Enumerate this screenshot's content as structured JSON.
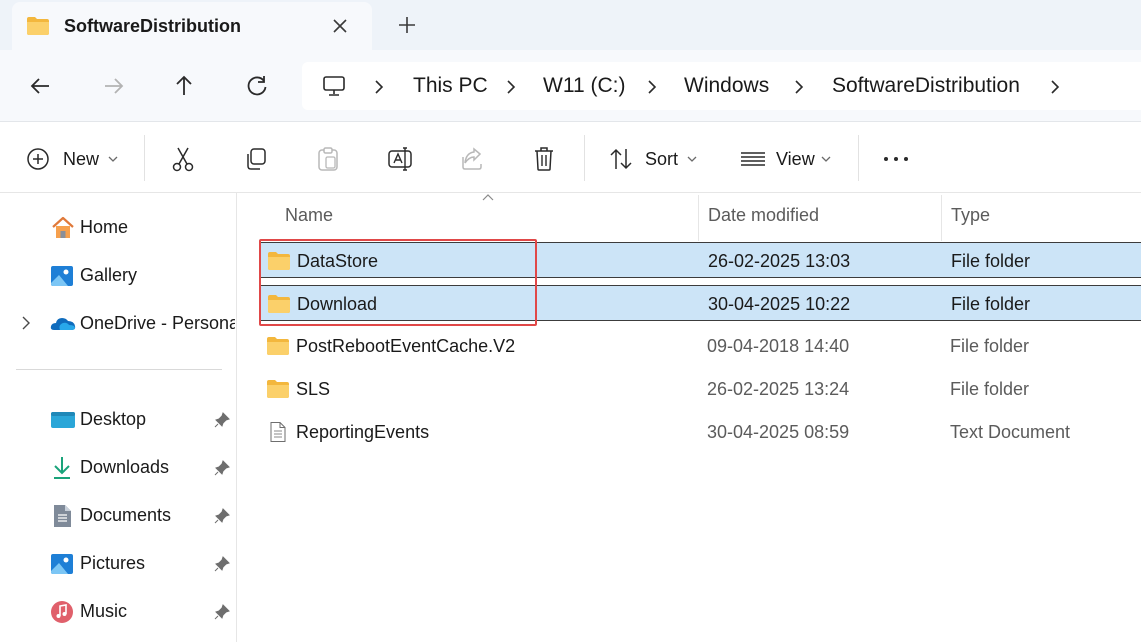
{
  "window": {
    "tab_title": "SoftwareDistribution",
    "new_tab_label": "+"
  },
  "breadcrumb": [
    "This PC",
    "W11 (C:)",
    "Windows",
    "SoftwareDistribution"
  ],
  "toolbar": {
    "new_label": "New",
    "sort_label": "Sort",
    "view_label": "View"
  },
  "sidebar": {
    "items": [
      {
        "label": "Home",
        "icon": "home-icon"
      },
      {
        "label": "Gallery",
        "icon": "gallery-icon"
      },
      {
        "label": "OneDrive - Personal",
        "icon": "onedrive-icon"
      }
    ],
    "pinned": [
      {
        "label": "Desktop",
        "icon": "desktop-icon"
      },
      {
        "label": "Downloads",
        "icon": "downloads-icon"
      },
      {
        "label": "Documents",
        "icon": "documents-icon"
      },
      {
        "label": "Pictures",
        "icon": "pictures-icon"
      },
      {
        "label": "Music",
        "icon": "music-icon"
      }
    ]
  },
  "columns": {
    "name": "Name",
    "date": "Date modified",
    "type": "Type"
  },
  "files": [
    {
      "name": "DataStore",
      "date": "26-02-2025 13:03",
      "type": "File folder",
      "selected": true,
      "icon": "folder-icon"
    },
    {
      "name": "Download",
      "date": "30-04-2025 10:22",
      "type": "File folder",
      "selected": true,
      "icon": "folder-icon"
    },
    {
      "name": "PostRebootEventCache.V2",
      "date": "09-04-2018 14:40",
      "type": "File folder",
      "selected": false,
      "icon": "folder-icon"
    },
    {
      "name": "SLS",
      "date": "26-02-2025 13:24",
      "type": "File folder",
      "selected": false,
      "icon": "folder-icon"
    },
    {
      "name": "ReportingEvents",
      "date": "30-04-2025 08:59",
      "type": "Text Document",
      "selected": false,
      "icon": "text-document-icon"
    }
  ],
  "colors": {
    "selection": "#cce4f7",
    "highlight": "#e04848",
    "folder": "#f8c244",
    "accent": "#0067c0"
  }
}
